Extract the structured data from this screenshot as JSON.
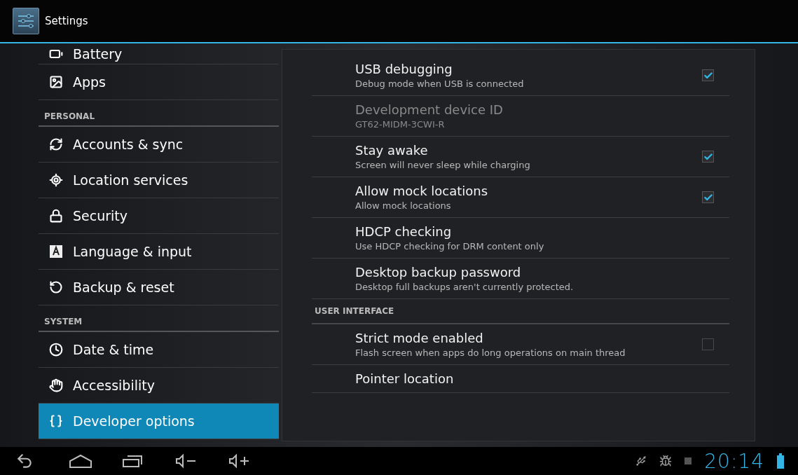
{
  "title_bar": {
    "title": "Settings"
  },
  "sidebar": {
    "items": [
      {
        "kind": "item",
        "label": "Battery",
        "selected": false
      },
      {
        "kind": "item",
        "label": "Apps",
        "selected": false
      },
      {
        "kind": "header",
        "label": "PERSONAL"
      },
      {
        "kind": "item",
        "label": "Accounts & sync",
        "selected": false
      },
      {
        "kind": "item",
        "label": "Location services",
        "selected": false
      },
      {
        "kind": "item",
        "label": "Security",
        "selected": false
      },
      {
        "kind": "item",
        "label": "Language & input",
        "selected": false
      },
      {
        "kind": "item",
        "label": "Backup & reset",
        "selected": false
      },
      {
        "kind": "header",
        "label": "SYSTEM"
      },
      {
        "kind": "item",
        "label": "Date & time",
        "selected": false
      },
      {
        "kind": "item",
        "label": "Accessibility",
        "selected": false
      },
      {
        "kind": "item",
        "label": "Developer options",
        "selected": true
      }
    ]
  },
  "preferences": [
    {
      "kind": "checkbox",
      "title": "USB debugging",
      "summary": "Debug mode when USB is connected",
      "checked": true,
      "disabled": false
    },
    {
      "kind": "plain",
      "title": "Development device ID",
      "summary": "GT62-MIDM-3CWI-R",
      "disabled": true
    },
    {
      "kind": "checkbox",
      "title": "Stay awake",
      "summary": "Screen will never sleep while charging",
      "checked": true,
      "disabled": false
    },
    {
      "kind": "checkbox",
      "title": "Allow mock locations",
      "summary": "Allow mock locations",
      "checked": true,
      "disabled": false
    },
    {
      "kind": "plain",
      "title": "HDCP checking",
      "summary": "Use HDCP checking for DRM content only",
      "disabled": false
    },
    {
      "kind": "plain",
      "title": "Desktop backup password",
      "summary": "Desktop full backups aren't currently protected.",
      "disabled": false
    },
    {
      "kind": "header",
      "title": "USER INTERFACE"
    },
    {
      "kind": "checkbox",
      "title": "Strict mode enabled",
      "summary": "Flash screen when apps do long operations on main thread",
      "checked": false,
      "disabled": false
    },
    {
      "kind": "plain",
      "title": "Pointer location",
      "disabled": false
    }
  ],
  "status_bar": {
    "time": "20:14"
  }
}
